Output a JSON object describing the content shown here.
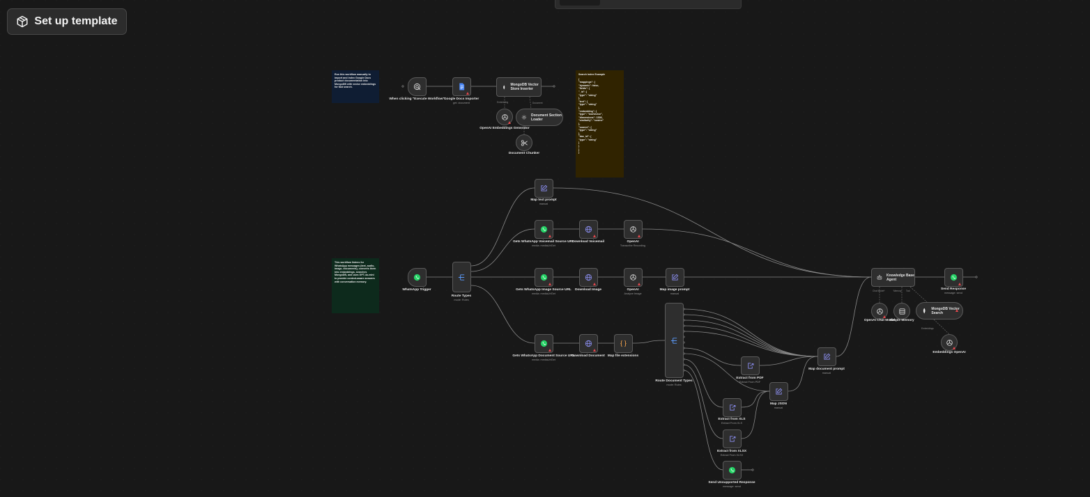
{
  "toolbar": {
    "setup_label": "Set up template",
    "setup_icon": "package-icon"
  },
  "stickies": {
    "import_note": "Run this workflow manually to import and index Google Docs product documentation into MongoDB with vector embeddings for fast search.",
    "chat_note": "This workflow listens for WhatsApp messages (text, audio, image, documents), converts them into embeddings, searches MongoDB, and uses GPT-4o-mini to provide context-aware answers with conversation memory.",
    "index_title": "Search index Example",
    "index_json": "{\n\"mappings\": {\n\"dynamic\": false,\n\"fields\": {\n\"_id\": {\n\"type\": \"string\"\n},\n\"text\": {\n\"type\": \"string\"\n},\n\"embedding\": {\n\"type\": \"knnVector\",\n\"dimensions\": 1536,\n\"similarity\": \"cosine\"\n},\n\"source\": {\n\"type\": \"string\"\n},\n\"doc_id\": {\n\"type\": \"string\"\n}\n}\n}\n}"
  },
  "nodes": {
    "manual_trigger": {
      "title": "When clicking \"Execute Workflow\"",
      "sub": ""
    },
    "gdocs": {
      "title": "Google Docs Importer",
      "sub": "get: document"
    },
    "mongo_insert": {
      "title": "MongoDB Vector Store Inserter"
    },
    "openai_embed_1": {
      "title": "OpenAI Embeddings Generator",
      "sub": ""
    },
    "doc_loader": {
      "title": "Document Section Loader"
    },
    "chunker": {
      "title": "Document Chunker",
      "sub": ""
    },
    "map_text": {
      "title": "Map text prompt",
      "sub": "manual"
    },
    "get_voicemail": {
      "title": "Gets WhatsApp Voicemail Source URL",
      "sub": "media: mediaUrlGet"
    },
    "download_voicemail": {
      "title": "Download Voicemail",
      "sub": ""
    },
    "openai_transcribe": {
      "title": "OpenAI",
      "sub": "Transcribe Recording"
    },
    "whatsapp_trigger": {
      "title": "WhatsApp Trigger",
      "sub": ""
    },
    "route_types": {
      "title": "Route Types",
      "sub": "mode: Rules"
    },
    "get_image": {
      "title": "Gets WhatsApp Image Source URL",
      "sub": "media: mediaUrlGet"
    },
    "download_image": {
      "title": "Download Image",
      "sub": ""
    },
    "openai_analyze": {
      "title": "OpenAI",
      "sub": "Analyze Image"
    },
    "map_image": {
      "title": "Map image prompt",
      "sub": "manual"
    },
    "agent": {
      "title": "Knowledge Base Agent"
    },
    "send_response": {
      "title": "Send Response",
      "sub": "message: send"
    },
    "chat_model": {
      "title": "OpenAI Chat Model",
      "sub": ""
    },
    "memory": {
      "title": "Simple Memory",
      "sub": ""
    },
    "mongo_search": {
      "title": "MongoDB Vector Search"
    },
    "embed_openai": {
      "title": "Embeddings OpenAI",
      "sub": ""
    },
    "get_document": {
      "title": "Gets WhatsApp Document Source URL",
      "sub": "media: mediaUrlGet"
    },
    "download_document": {
      "title": "Download Document",
      "sub": ""
    },
    "map_ext": {
      "title": "Map file extensions",
      "sub": ""
    },
    "route_doc": {
      "title": "Route Document Types",
      "sub": "mode: Rules"
    },
    "extract_pdf": {
      "title": "Extract from PDF",
      "sub": "Extract From PDF"
    },
    "map_json": {
      "title": "Map JSON",
      "sub": "manual"
    },
    "map_doc": {
      "title": "Map document prompt",
      "sub": "manual"
    },
    "extract_xls": {
      "title": "Extract from XLS",
      "sub": "Extract From XLS"
    },
    "extract_xlsx": {
      "title": "Extract from XLSX",
      "sub": "Extract From XLSX"
    },
    "send_unsupported": {
      "title": "Send Unsupported Response",
      "sub": "message: send"
    }
  },
  "ports": {
    "embedding": "Embedding",
    "document": "Document",
    "text_splitter": "Text Splitter",
    "chat_model": "Chat Model*",
    "memory": "Memory",
    "tool": "Tool",
    "embeddings": "Embeddings"
  }
}
